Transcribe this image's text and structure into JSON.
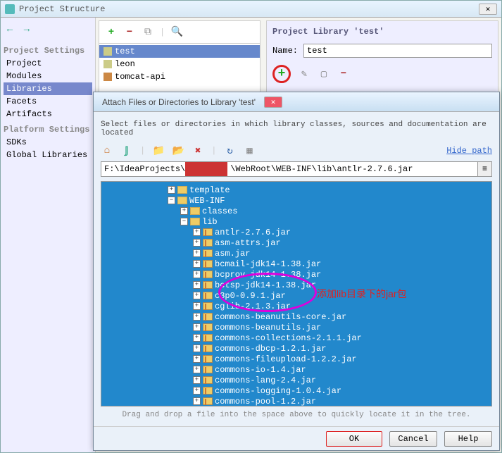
{
  "mainWindow": {
    "title": "Project Structure",
    "sidebar": {
      "hdr1": "Project Settings",
      "items1": [
        "Project",
        "Modules",
        "Libraries",
        "Facets",
        "Artifacts"
      ],
      "selected1": 2,
      "hdr2": "Platform Settings",
      "items2": [
        "SDKs",
        "Global Libraries"
      ]
    },
    "center": {
      "items": [
        "test",
        "leon",
        "tomcat-api"
      ],
      "selected": 0
    },
    "right": {
      "title": "Project Library 'test'",
      "nameLabel": "Name:",
      "nameValue": "test"
    }
  },
  "dialog": {
    "title": "Attach Files or Directories to Library 'test'",
    "hint": "Select files or directories in which library classes, sources and documentation are located",
    "hideLink": "Hide path",
    "pathPrefix": "F:\\IdeaProjects\\",
    "pathSuffix": "\\WebRoot\\WEB-INF\\lib\\antlr-2.7.6.jar",
    "treeTop": [
      "template",
      "WEB-INF",
      "classes",
      "lib"
    ],
    "jars": [
      "antlr-2.7.6.jar",
      "asm-attrs.jar",
      "asm.jar",
      "bcmail-jdk14-1.38.jar",
      "bcprov-jdk14-1.38.jar",
      "bctsp-jdk14-1.38.jar",
      "c3p0-0.9.1.jar",
      "cglib-2.1.3.jar",
      "commons-beanutils-core.jar",
      "commons-beanutils.jar",
      "commons-collections-2.1.1.jar",
      "commons-dbcp-1.2.1.jar",
      "commons-fileupload-1.2.2.jar",
      "commons-io-1.4.jar",
      "commons-lang-2.4.jar",
      "commons-logging-1.0.4.jar",
      "commons-pool-1.2.jar"
    ],
    "footer": "Drag and drop a file into the space above to quickly locate it in the tree.",
    "ok": "OK",
    "cancel": "Cancel",
    "help": "Help"
  },
  "annot": "添加lib目录下的jar包"
}
